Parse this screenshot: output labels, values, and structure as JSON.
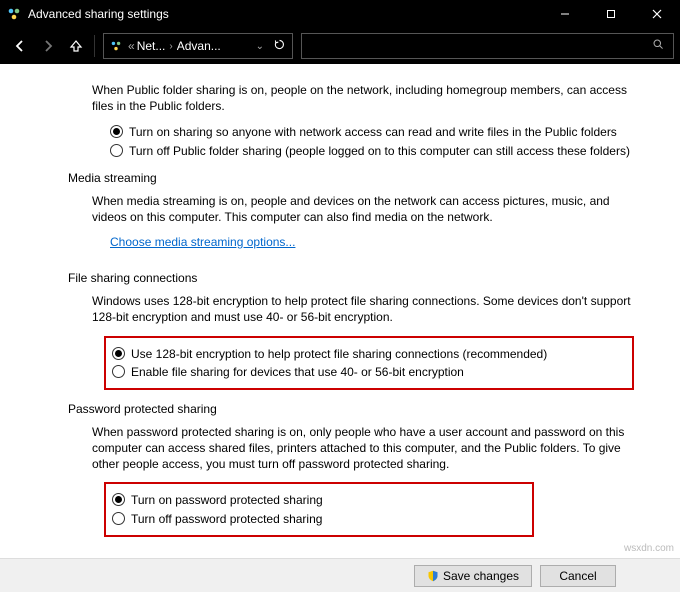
{
  "titlebar": {
    "title": "Advanced sharing settings"
  },
  "breadcrumb": {
    "prefix": "«",
    "item1": "Net...",
    "item2": "Advan..."
  },
  "public_folder": {
    "desc": "When Public folder sharing is on, people on the network, including homegroup members, can access files in the Public folders.",
    "opt_on": "Turn on sharing so anyone with network access can read and write files in the Public folders",
    "opt_off": "Turn off Public folder sharing (people logged on to this computer can still access these folders)"
  },
  "media": {
    "head": "Media streaming",
    "desc": "When media streaming is on, people and devices on the network can access pictures, music, and videos on this computer. This computer can also find media on the network.",
    "link": "Choose media streaming options..."
  },
  "file_sharing": {
    "head": "File sharing connections",
    "desc": "Windows uses 128-bit encryption to help protect file sharing connections. Some devices don't support 128-bit encryption and must use 40- or 56-bit encryption.",
    "opt_128": "Use 128-bit encryption to help protect file sharing connections (recommended)",
    "opt_40": "Enable file sharing for devices that use 40- or 56-bit encryption"
  },
  "password": {
    "head": "Password protected sharing",
    "desc": "When password protected sharing is on, only people who have a user account and password on this computer can access shared files, printers attached to this computer, and the Public folders. To give other people access, you must turn off password protected sharing.",
    "opt_on": "Turn on password protected sharing",
    "opt_off": "Turn off password protected sharing"
  },
  "footer": {
    "save": "Save changes",
    "cancel": "Cancel"
  },
  "watermark": "wsxdn.com"
}
